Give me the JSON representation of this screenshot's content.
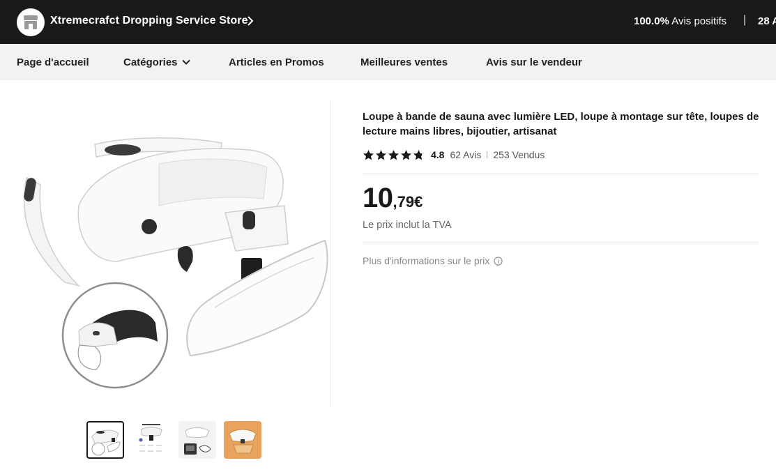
{
  "store": {
    "name": "Xtremecrafct Dropping Service Store",
    "rating_value": "100.0%",
    "rating_label": "Avis positifs",
    "separator": "|",
    "followers": "28 A"
  },
  "nav": {
    "items": [
      {
        "label": "Page d'accueil"
      },
      {
        "label": "Catégories"
      },
      {
        "label": "Articles en Promos"
      },
      {
        "label": "Meilleures ventes"
      },
      {
        "label": "Avis sur le vendeur"
      }
    ]
  },
  "gallery": {
    "thumbnails": [
      "thumbnail-1",
      "thumbnail-2",
      "thumbnail-3",
      "thumbnail-4"
    ],
    "selected_index": 0
  },
  "product": {
    "title": "Loupe à bande de sauna avec lumière LED, loupe à montage sur tête, loupes de lecture mains libres, bijoutier, artisanat",
    "rating": "4.8",
    "stars_filled": 4.8,
    "reviews": "62 Avis",
    "sold": "253 Vendus",
    "price_int": "10",
    "price_dec": ",79",
    "currency": "€",
    "tva_note": "Le prix inclut la TVA",
    "more_info": "Plus d'informations sur le prix"
  },
  "colors": {
    "header_bg": "#191919",
    "nav_bg": "#f2f2f2",
    "thumb4_bg": "#e8a45c"
  }
}
